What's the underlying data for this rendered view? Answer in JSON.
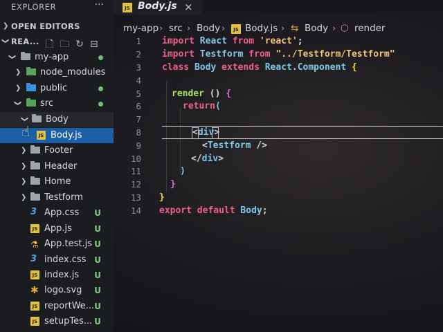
{
  "explorer": {
    "title": "EXPLORER",
    "more": "···",
    "open_editors": "OPEN EDITORS",
    "workspace": "REA...",
    "tree": [
      {
        "label": "my-app",
        "status": "dot"
      },
      {
        "label": "node_modules"
      },
      {
        "label": "public",
        "status": "dot"
      },
      {
        "label": "src",
        "status": "dot"
      },
      {
        "label": "Body"
      },
      {
        "label": "Body.js"
      },
      {
        "label": "Footer"
      },
      {
        "label": "Header"
      },
      {
        "label": "Home"
      },
      {
        "label": "Testform"
      },
      {
        "label": "App.css",
        "status": "U"
      },
      {
        "label": "App.js",
        "status": "U"
      },
      {
        "label": "App.test.js",
        "status": "U"
      },
      {
        "label": "index.css",
        "status": "U"
      },
      {
        "label": "index.js",
        "status": "U"
      },
      {
        "label": "logo.svg",
        "status": "U"
      },
      {
        "label": "reportWe...",
        "status": "U"
      },
      {
        "label": "setupTes...",
        "status": "U"
      }
    ]
  },
  "tab": {
    "label": "Body.js",
    "close": "×",
    "icon": "JS"
  },
  "breadcrumb": [
    "my-app",
    "src",
    "Body",
    "Body.js",
    "Body",
    "render"
  ],
  "line_numbers": [
    "1",
    "2",
    "3",
    "4",
    "5",
    "6",
    "7",
    "8",
    "9",
    "10",
    "11",
    "12",
    "13",
    "14"
  ],
  "code": {
    "l1": {
      "a": "import",
      "b": "React",
      "c": "from",
      "d": "'react'",
      "e": ";"
    },
    "l2": {
      "a": "import",
      "b": "Testform",
      "c": "from",
      "d": "\"../Testform/Testform\""
    },
    "l3": {
      "a": "class",
      "b": "Body",
      "c": "extends",
      "d": "React",
      "e": ".",
      "f": "Component",
      "g": "{"
    },
    "l5": {
      "a": "render",
      "b": "() ",
      "c": "{"
    },
    "l6": {
      "a": "return",
      "b": "("
    },
    "l8": {
      "a": "<",
      "b": "div",
      "c": ">"
    },
    "l9": {
      "a": "<",
      "b": "Testform",
      "c": " />"
    },
    "l10": {
      "a": "</",
      "b": "div",
      "c": ">"
    },
    "l11": {
      "a": ")"
    },
    "l12": {
      "a": "}"
    },
    "l13": {
      "a": "}"
    },
    "l14": {
      "a": "export",
      "b": "default",
      "c": "Body",
      "d": ";"
    }
  },
  "colors": {
    "keyword": "#ee5f8a",
    "class": "#7fc9e6",
    "string": "#f0c674",
    "selection": "#1c5fa7",
    "untracked": "#7ecb81"
  }
}
